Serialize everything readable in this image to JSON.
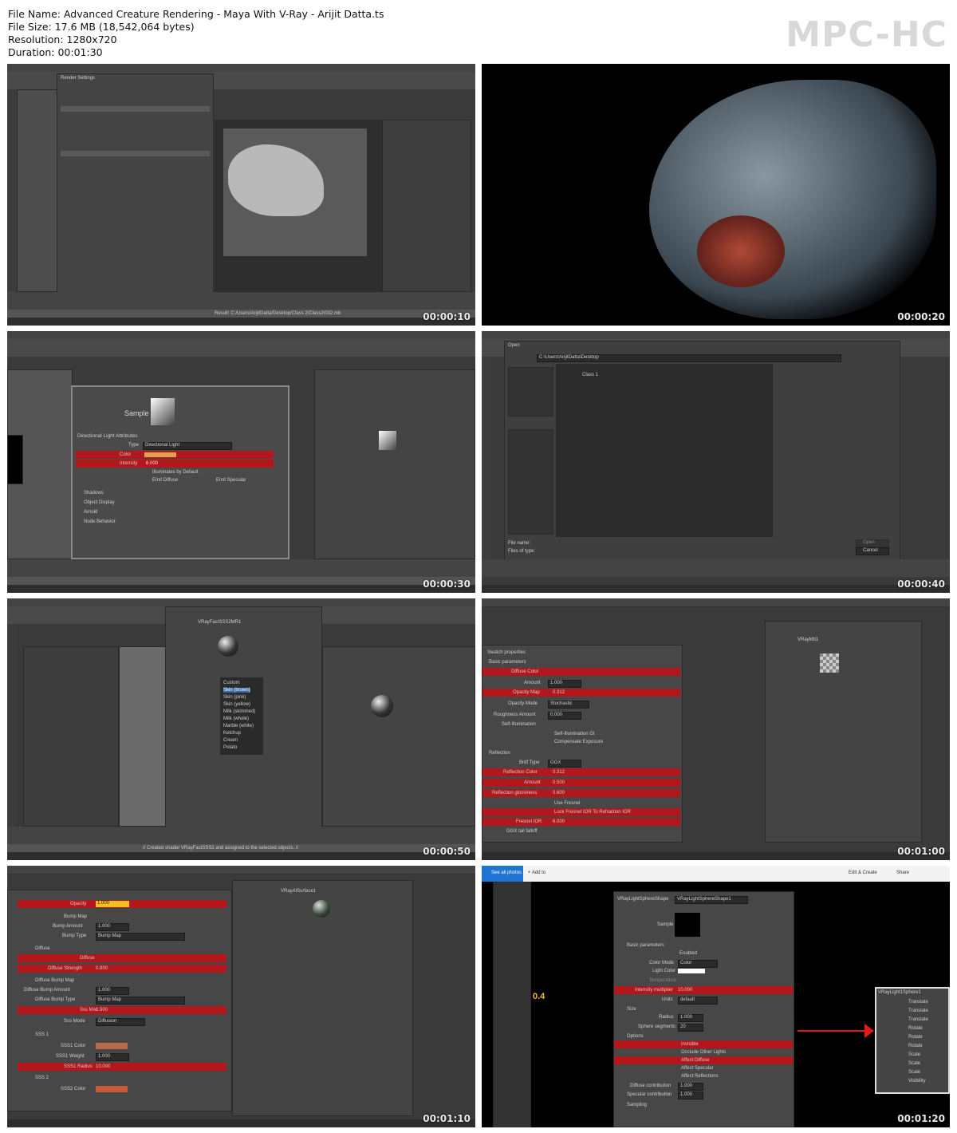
{
  "header": {
    "file_name": "File Name: Advanced Creature Rendering - Maya With V-Ray - Arijit Datta.ts",
    "file_size": "File Size: 17.6 MB (18,542,064 bytes)",
    "resolution": "Resolution: 1280x720",
    "duration": "Duration: 00:01:30"
  },
  "brand": "MPC-HC",
  "thumbnails": [
    {
      "timestamp": "00:00:10",
      "dialog_title": "Render Settings",
      "path": "Result: C:/Users/ArijitDatta/Desktop/Class 2/Class2/002.mb"
    },
    {
      "timestamp": "00:00:20"
    },
    {
      "timestamp": "00:00:30",
      "section": "Directional Light Attributes",
      "type_label": "Type",
      "type_value": "Directional Light",
      "color_label": "Color",
      "intensity_label": "Intensity",
      "intensity_value": "6.000",
      "illum": "Illuminates by Default",
      "emit_diffuse": "Emit Diffuse",
      "emit_specular": "Emit Specular",
      "shadows": "Shadows",
      "object_display": "Object Display",
      "arnold": "Arnold",
      "node_behavior": "Node Behavior",
      "sample": "Sample"
    },
    {
      "timestamp": "00:00:40",
      "dialog_title": "Open",
      "look_in": "C:\\Users\\ArijitDatta\\Desktop",
      "file_name_label": "File name:",
      "files_of_type": "Files of type:",
      "open_btn": "Open",
      "cancel_btn": "Cancel",
      "folder": "Class 1"
    },
    {
      "timestamp": "00:00:50",
      "shader": "VRayFastSSS2MR1",
      "menu_items": [
        "Custom",
        "Skin (brown)",
        "Skin (pink)",
        "Skin (yellow)",
        "Milk (skimmed)",
        "Milk (whole)",
        "Marble (white)",
        "Ketchup",
        "Cream",
        "Potato"
      ],
      "status": "// Created shader VRayFastSSS2 and assigned to the selected objects. //"
    },
    {
      "timestamp": "00:01:00",
      "swatch": "Swatch properties",
      "basic": "Basic parameters",
      "diffuse_color": "Diffuse Color",
      "amount": "Amount",
      "amount_value": "1.000",
      "opacity_map": "Opacity Map",
      "opacity_map_value": "0.312",
      "opacity_mode": "Opacity Mode",
      "opacity_mode_value": "Stochastic",
      "roughness": "Roughness Amount",
      "roughness_value": "0.000",
      "self_illum": "Self-Illumination",
      "self_gi": "Self-Illumination GI",
      "comp_exp": "Compensate Exposure",
      "reflection": "Reflection",
      "brdf": "Brdf Type",
      "brdf_value": "GGX",
      "refl_color": "Reflection Color",
      "refl_color_value": "0.312",
      "refl_amount": "Amount",
      "refl_amount_value": "0.500",
      "refl_gloss": "Reflection glossiness",
      "refl_gloss_value": "0.600",
      "use_fresnel": "Use Fresnel",
      "lock_fresnel": "Lock Fresnel IOR To Refraction IOR",
      "fresnel_ior": "Fresnel IOR",
      "fresnel_ior_value": "6.000",
      "ggx": "GGX tail falloff",
      "material": "VRayMtl1"
    },
    {
      "timestamp": "00:01:10",
      "opacity": "Opacity",
      "opacity_value": "1.000",
      "bump_map": "Bump Map",
      "bump_amount": "Bump Amount",
      "bump_amount_value": "1.000",
      "bump_type": "Bump Type",
      "bump_type_value": "Bump Map",
      "diffuse": "Diffuse",
      "diffuse2": "Diffuse",
      "diffuse_strength": "Diffuse Strength",
      "diffuse_strength_value": "0.800",
      "diffuse_bump_map": "Diffuse Bump Map",
      "diffuse_bump_amount": "Diffuse Bump Amount",
      "diffuse_bump_amount_value": "1.000",
      "diffuse_bump_type": "Diffuse Bump Type",
      "diffuse_bump_type_value": "Bump Map",
      "sss_mix": "Sss Mix",
      "sss_mix_value": "0.500",
      "sss_mode": "Sss Mode",
      "sss_mode_value": "Diffusion",
      "sss1": "SSS 1",
      "sss1_color": "SSS1 Color",
      "sss1_weight": "SSS1 Weight",
      "sss1_weight_value": "1.000",
      "sss1_radius": "SSS1 Radius",
      "sss1_radius_value": "10.000",
      "sss2": "SSS 2",
      "sss2_color": "SSS2 Color",
      "shader": "VRayAlSurface1"
    },
    {
      "timestamp": "00:01:20",
      "shape": "VRayLightSphereShape",
      "shape_value": "VRayLightSphereShape1",
      "sample": "Sample",
      "basic": "Basic parameters",
      "enabled": "Enabled",
      "color_mode": "Color Mode",
      "color_mode_value": "Color",
      "light_color": "Light Color",
      "temperature": "Temperature",
      "intensity_mult": "Intensity multiplier",
      "intensity_mult_value": "10.000",
      "units": "Units",
      "units_value": "default",
      "size": "Size",
      "radius": "Radius",
      "radius_value": "1.000",
      "segments": "Sphere segments",
      "segments_value": "20",
      "options": "Options",
      "invisible": "Invisible",
      "occlude": "Occlude Other Lights",
      "affect_diffuse": "Affect Diffuse",
      "affect_specular": "Affect Specular",
      "affect_reflections": "Affect Reflections",
      "diffuse_contrib": "Diffuse contribution",
      "diffuse_contrib_value": "1.000",
      "spec_contrib": "Specular contribution",
      "spec_contrib_value": "1.000",
      "sampling": "Sampling",
      "see_all": "See all photos",
      "add_to": "+ Add to",
      "edit_create": "Edit & Create",
      "share": "Share",
      "callout": "0.4",
      "outliner": "VRayLight1Sphere1",
      "channels": [
        "Translate",
        "Translate",
        "Translate",
        "Rotate",
        "Rotate",
        "Rotate",
        "Scale",
        "Scale",
        "Scale",
        "Visibility"
      ]
    }
  ],
  "colors": {
    "red": "#b3161b",
    "orange": "#e0a050",
    "yellow_accent": "#f0c020"
  }
}
